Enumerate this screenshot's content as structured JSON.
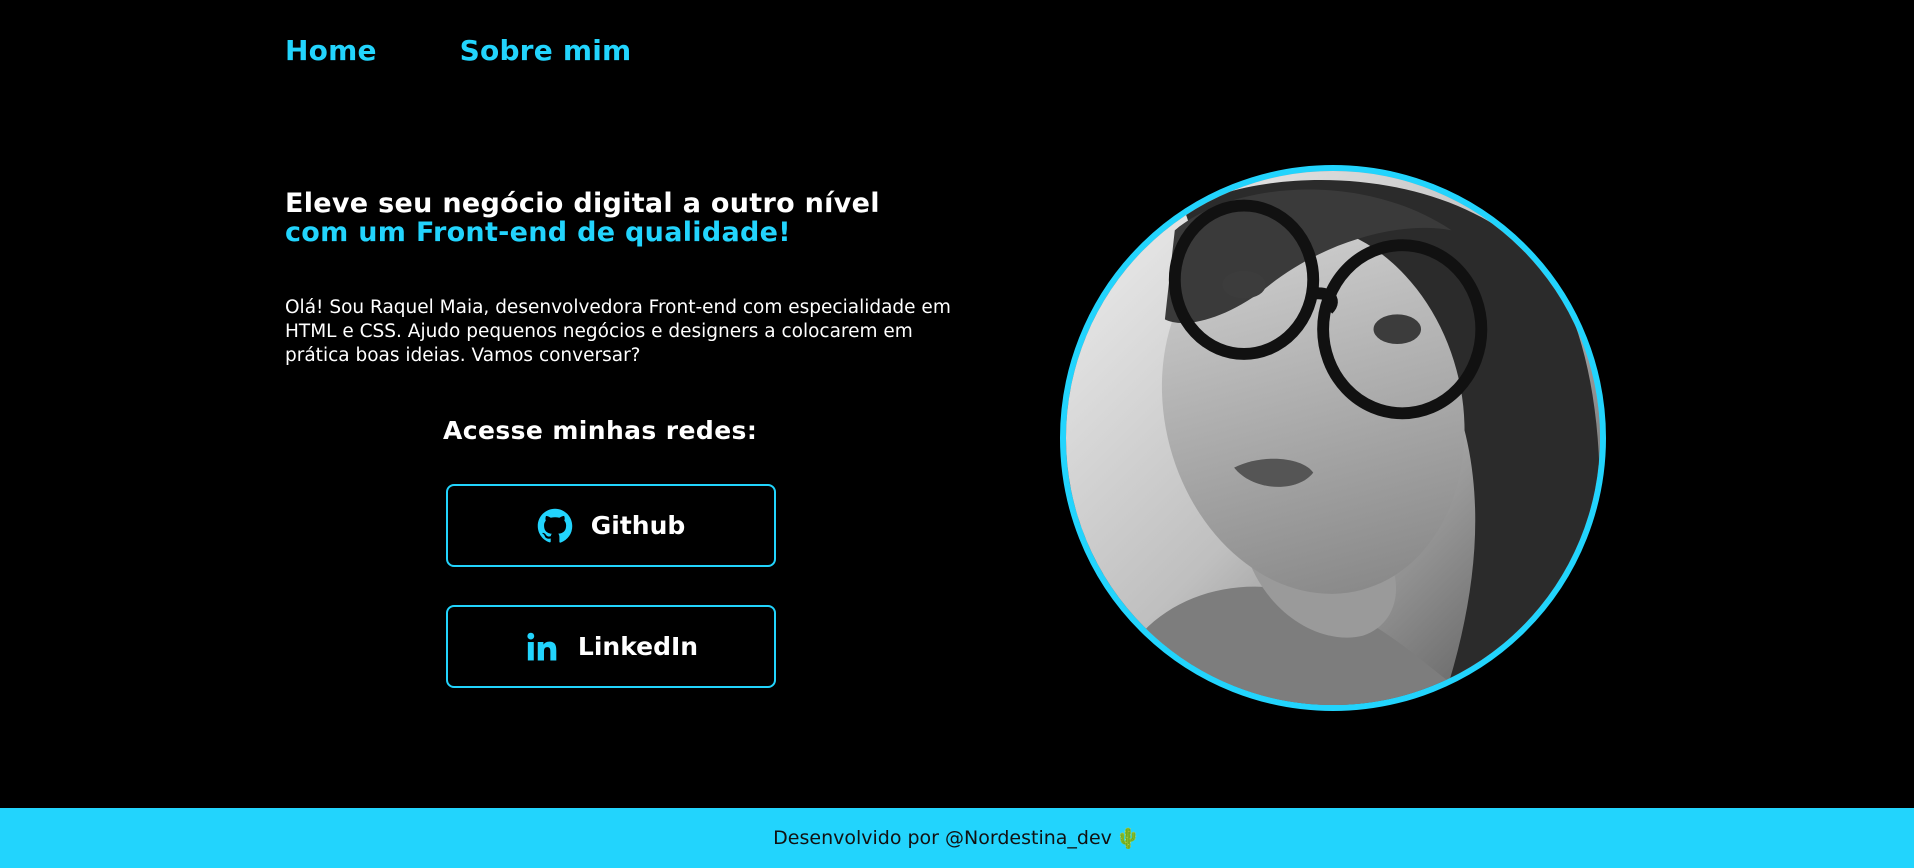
{
  "nav": {
    "home": "Home",
    "about": "Sobre mim"
  },
  "hero": {
    "headline_white": "Eleve seu negócio digital a outro nível ",
    "headline_accent": "com um Front-end de qualidade!",
    "intro": "Olá! Sou Raquel Maia, desenvolvedora Front-end com especialidade em HTML e CSS. Ajudo pequenos negócios e designers a colocarem em prática boas ideias. Vamos conversar?"
  },
  "socials": {
    "title": "Acesse minhas redes:",
    "github_label": "Github",
    "linkedin_label": "LinkedIn",
    "github_icon": "github-icon",
    "linkedin_icon": "linkedin-icon"
  },
  "footer": {
    "credit": "Desenvolvido por @Nordestina_dev",
    "emoji": "🌵"
  },
  "colors": {
    "accent": "#22d4fd",
    "background": "#000000",
    "text": "#ffffff"
  }
}
